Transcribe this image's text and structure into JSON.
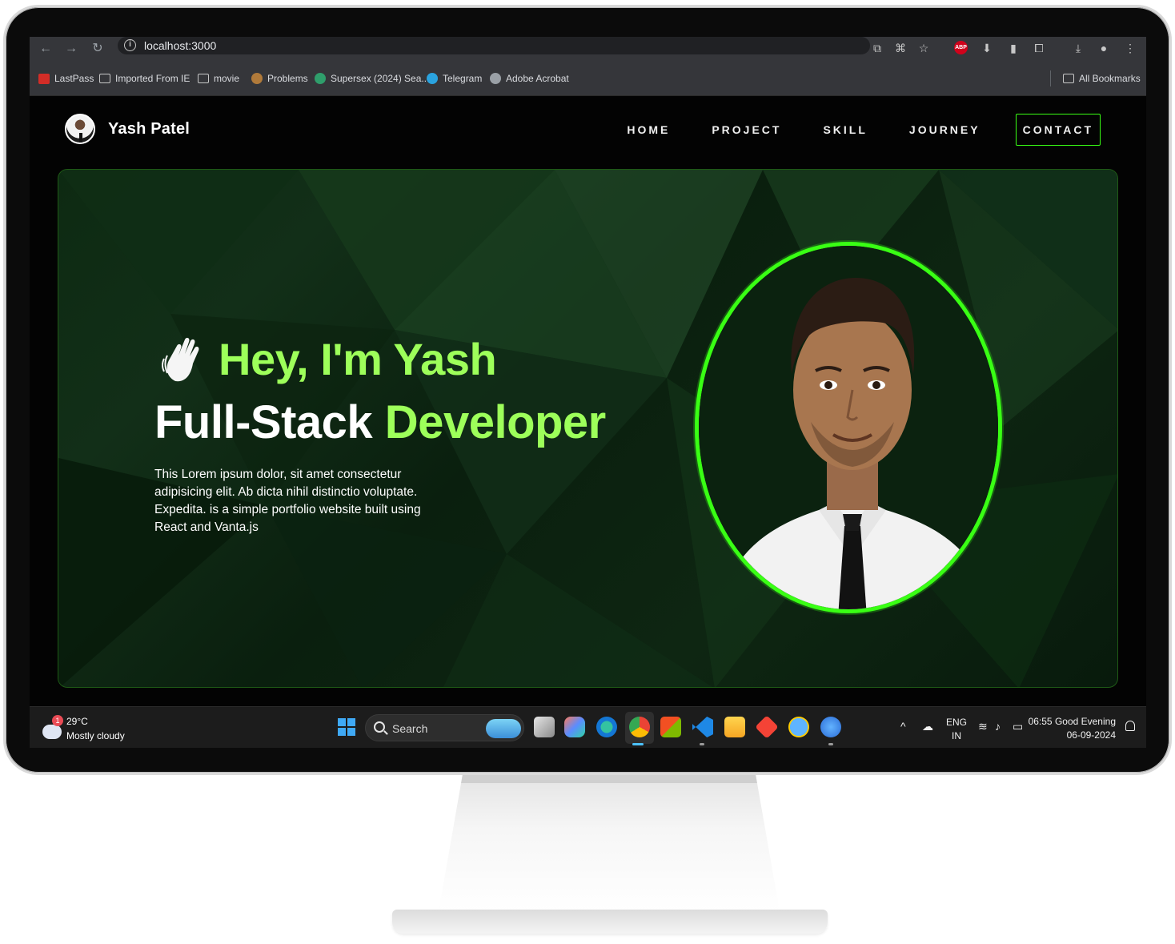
{
  "browser": {
    "url": "localhost:3000",
    "bookmarks": [
      {
        "label": "LastPass",
        "icon": "lastpass-icon"
      },
      {
        "label": "Imported From IE",
        "icon": "folder-icon"
      },
      {
        "label": "movie",
        "icon": "folder-icon"
      },
      {
        "label": "Problems",
        "icon": "codechef-icon"
      },
      {
        "label": "Supersex (2024) Sea...",
        "icon": "site-icon"
      },
      {
        "label": "Telegram",
        "icon": "telegram-icon"
      },
      {
        "label": "Adobe Acrobat",
        "icon": "acrobat-icon"
      }
    ],
    "all_bookmarks": "All Bookmarks",
    "extension_badge": "ABP"
  },
  "site": {
    "brand": "Yash Patel",
    "nav": [
      "HOME",
      "PROJECT",
      "SKILL",
      "JOURNEY"
    ],
    "contact": "CONTACT",
    "greeting": "Hey, I'm Yash",
    "role_white": "Full-Stack",
    "role_green": "Developer",
    "description": "This Lorem ipsum dolor, sit amet consectetur adipisicing elit. Ab dicta nihil distinctio voluptate. Expedita. is a simple portfolio website built using React and Vanta.js",
    "accent": "#39ff14",
    "accent_text": "#9dff5a"
  },
  "taskbar": {
    "weather_temp": "29°C",
    "weather_desc": "Mostly cloudy",
    "weather_badge": "1",
    "search": "Search",
    "lang_top": "ENG",
    "lang_bottom": "IN",
    "time": "06:55 Good Evening",
    "date": "06-09-2024"
  }
}
